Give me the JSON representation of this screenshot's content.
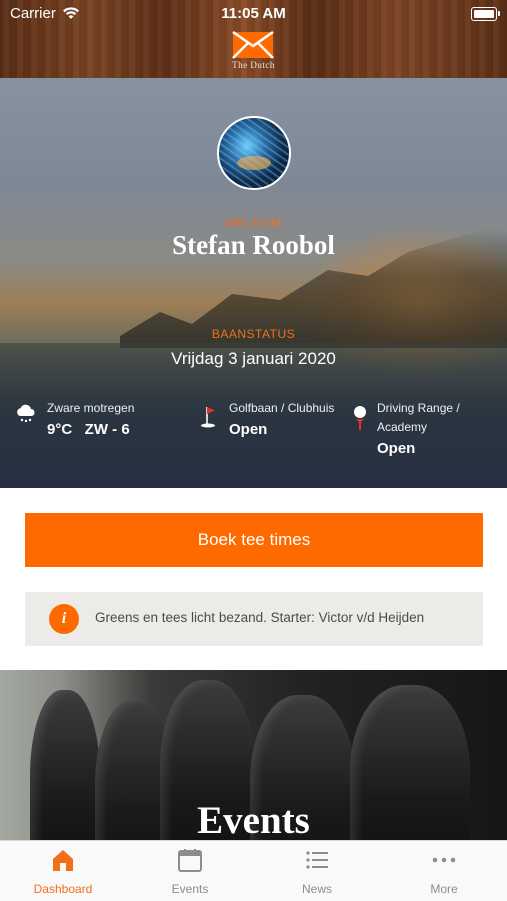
{
  "status_bar": {
    "carrier": "Carrier",
    "time": "11:05 AM"
  },
  "brand": {
    "logo_text": "The Dutch"
  },
  "profile": {
    "welcome_label": "WELKOM",
    "name": "Stefan Roobol"
  },
  "course_status": {
    "label": "BAANSTATUS",
    "date": "Vrijdag 3 januari 2020",
    "weather": {
      "description": "Zware motregen",
      "value": "9°C   ZW - 6",
      "icon": "cloud-rain-icon"
    },
    "golf_course": {
      "label": "Golfbaan / Clubhuis",
      "status": "Open",
      "icon": "golf-flag-icon"
    },
    "driving_range": {
      "label": "Driving Range / Academy",
      "status": "Open",
      "icon": "golf-ball-tee-icon"
    }
  },
  "actions": {
    "book_label": "Boek tee times"
  },
  "notice": {
    "icon_glyph": "i",
    "text": "Greens en tees licht bezand. Starter: Victor v/d Heijden"
  },
  "events_section": {
    "title": "Events"
  },
  "tabs": [
    {
      "label": "Dashboard",
      "icon": "home-icon",
      "active": true
    },
    {
      "label": "Events",
      "icon": "calendar-icon",
      "active": false
    },
    {
      "label": "News",
      "icon": "list-icon",
      "active": false
    },
    {
      "label": "More",
      "icon": "more-icon",
      "active": false
    }
  ],
  "colors": {
    "accent": "#ff6a00",
    "accent_text": "#f26f19",
    "notice_bg": "#ecebe8",
    "tab_inactive": "#8d8d8d"
  }
}
